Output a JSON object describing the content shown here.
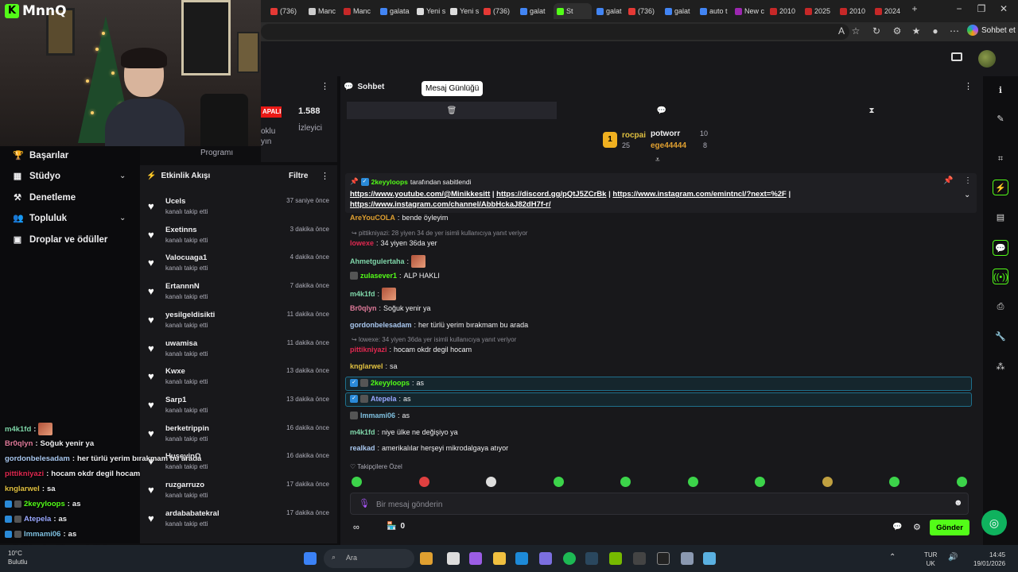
{
  "browser": {
    "tabs": [
      {
        "label": "(736)",
        "color": "#e53935"
      },
      {
        "label": "Manc",
        "color": "#cccccc"
      },
      {
        "label": "Manc",
        "color": "#c62828"
      },
      {
        "label": "galata",
        "color": "#4285f4"
      },
      {
        "label": "Yeni s",
        "color": "#dddddd"
      },
      {
        "label": "Yeni s",
        "color": "#dddddd"
      },
      {
        "label": "(736)",
        "color": "#e53935"
      },
      {
        "label": "galat",
        "color": "#4285f4"
      },
      {
        "label": "St",
        "color": "#53fc18"
      },
      {
        "label": "galat",
        "color": "#4285f4"
      },
      {
        "label": "(736)",
        "color": "#e53935"
      },
      {
        "label": "galat",
        "color": "#4285f4"
      },
      {
        "label": "auto t",
        "color": "#4285f4"
      },
      {
        "label": "New c",
        "color": "#9c27b0"
      },
      {
        "label": "2010",
        "color": "#c62828"
      },
      {
        "label": "2025",
        "color": "#c62828"
      },
      {
        "label": "2010",
        "color": "#c62828"
      },
      {
        "label": "2024",
        "color": "#c62828"
      }
    ],
    "chat_button": "Sohbet et"
  },
  "webcam": {
    "logo": "MnnQ"
  },
  "sidebar": {
    "items": [
      {
        "label": "Başarılar",
        "icon": "trophy-icon"
      },
      {
        "label": "Stüdyo",
        "icon": "studio-icon",
        "expandable": true
      },
      {
        "label": "Denetleme",
        "icon": "gavel-icon"
      },
      {
        "label": "Topluluk",
        "icon": "community-icon",
        "expandable": true
      },
      {
        "label": "Droplar ve ödüller",
        "icon": "gift-icon"
      }
    ]
  },
  "overlay_chat": [
    {
      "user": "m4k1fd",
      "text": "",
      "color": "#7fd6a9",
      "emote": true
    },
    {
      "user": "Br0qlyn",
      "text": "Soğuk yenir ya",
      "color": "#e07a9a"
    },
    {
      "user": "gordonbelesadam",
      "text": "her türlü yerim bırakmam bu arada",
      "color": "#a9c8f0"
    },
    {
      "user": "pittikniyazi",
      "text": "hocam okdr degil hocam",
      "color": "#e02850"
    },
    {
      "user": "knglarwel",
      "text": "sa",
      "color": "#e0c040"
    },
    {
      "user": "2keyyloops",
      "text": "as",
      "color": "#53fc18",
      "badges": true
    },
    {
      "user": "Atepela",
      "text": "as",
      "color": "#9aa8ff",
      "badges": true
    },
    {
      "user": "Immami06",
      "text": "as",
      "color": "#7fc0e0",
      "badges": true
    },
    {
      "user": "m4k1fd",
      "text": "niye ülke ne değişiyo ya",
      "color": "#7fd6a9"
    }
  ],
  "stream": {
    "live": "APALI",
    "viewers": "1.588",
    "viewers_label": "İzleyici",
    "partial1": "oklu",
    "partial2": "yın",
    "program": "Programı"
  },
  "activity": {
    "title": "Etkinlik Akışı",
    "filter": "Filtre",
    "items": [
      {
        "name": "Ucels",
        "sub": "kanalı takip etti",
        "time": "37 saniye önce"
      },
      {
        "name": "Exetinns",
        "sub": "kanalı takip etti",
        "time": "3 dakika önce"
      },
      {
        "name": "Valocuaga1",
        "sub": "kanalı takip etti",
        "time": "4 dakika önce"
      },
      {
        "name": "ErtannnN",
        "sub": "kanalı takip etti",
        "time": "7 dakika önce"
      },
      {
        "name": "yesilgeldisikti",
        "sub": "kanalı takip etti",
        "time": "11 dakika önce"
      },
      {
        "name": "uwamisa",
        "sub": "kanalı takip etti",
        "time": "11 dakika önce"
      },
      {
        "name": "Kwxe",
        "sub": "kanalı takip etti",
        "time": "13 dakika önce"
      },
      {
        "name": "Sarp1",
        "sub": "kanalı takip etti",
        "time": "13 dakika önce"
      },
      {
        "name": "berketrippin",
        "sub": "kanalı takip etti",
        "time": "16 dakika önce"
      },
      {
        "name": "HuseyinO",
        "sub": "kanalı takip etti",
        "time": "16 dakika önce"
      },
      {
        "name": "ruzgarruzo",
        "sub": "kanalı takip etti",
        "time": "17 dakika önce"
      },
      {
        "name": "ardababatekral",
        "sub": "kanalı takip etti",
        "time": "17 dakika önce"
      }
    ]
  },
  "chat": {
    "title": "Sohbet",
    "tooltip": "Mesaj Günlüğü",
    "leaders": [
      {
        "rank": "1",
        "name": "rocpai",
        "count": "25"
      },
      {
        "name": "potworr",
        "count": "10"
      },
      {
        "name": "ege44444",
        "count": "8"
      }
    ],
    "pinned": {
      "by": "2keyyloops",
      "suffix": "tarafından sabitlendi",
      "links": [
        "https://www.youtube.com/@Minikkesitt",
        "https://discord.gg/pQtJ5ZCrBk",
        "https://www.instagram.com/emintncl/?next=%2F",
        "https://www.instagram.com/channel/AbbHckaJ82dH7f-r/"
      ]
    },
    "messages": [
      {
        "user": "AreYouCOLA",
        "text": "bende öyleyim",
        "color": "#e0a030"
      },
      {
        "reply": "pittikniyazi: 28 yiyen 34 de yer isimli kullanıcıya yanıt veriyor"
      },
      {
        "user": "lowexe",
        "text": "34 yiyen 36da yer",
        "color": "#e02850"
      },
      {
        "user": "Ahmetgulertaha",
        "text": "",
        "color": "#7fd6a9",
        "emote": true
      },
      {
        "user": "zulasever1",
        "text": "ALP HAKLI",
        "color": "#53fc18",
        "badge": true
      },
      {
        "user": "m4k1fd",
        "text": "",
        "color": "#7fd6a9",
        "emote": true
      },
      {
        "user": "Br0qlyn",
        "text": "Soğuk yenir ya",
        "color": "#e07a9a"
      },
      {
        "user": "gordonbelesadam",
        "text": "her türlü yerim bırakmam bu arada",
        "color": "#a9c8f0"
      },
      {
        "reply": "lowexe: 34 yiyen 36da yer isimli kullanıcıya yanıt veriyor"
      },
      {
        "user": "pittikniyazi",
        "text": "hocam okdr degil hocam",
        "color": "#e02850"
      },
      {
        "user": "knglarwel",
        "text": "sa",
        "color": "#e0c040"
      },
      {
        "user": "2keyyloops",
        "text": "as",
        "color": "#53fc18",
        "highlight": true,
        "badges": true
      },
      {
        "user": "Atepela",
        "text": "as",
        "color": "#9aa8ff",
        "highlight": true,
        "badges": true
      },
      {
        "user": "Immami06",
        "text": "as",
        "color": "#7fc0e0",
        "badge": true
      },
      {
        "user": "m4k1fd",
        "text": "niye ülke ne değişiyo ya",
        "color": "#7fd6a9"
      },
      {
        "user": "realkad",
        "text": "amerikalılar herşeyi mikrodalgaya atıyor",
        "color": "#a9c8f0"
      }
    ],
    "followers_only": "Takipçilere Özel",
    "input_placeholder": "Bir mesaj gönderin",
    "points": "0",
    "send": "Gönder"
  },
  "taskbar": {
    "weather_temp": "10°C",
    "weather_text": "Bulutlu",
    "search": "Ara",
    "lang1": "TUR",
    "lang2": "UK",
    "time": "14:45",
    "date": "19/01/2026"
  }
}
